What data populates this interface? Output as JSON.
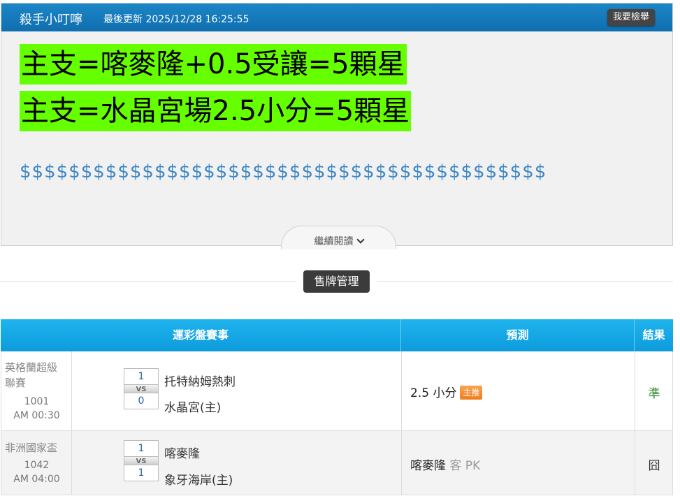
{
  "header": {
    "author": "殺手小叮嚀",
    "updated": "最後更新 2025/12/28 16:25:55",
    "report_button": "我要檢舉"
  },
  "article": {
    "headline_1": "主支=喀麥隆+0.5受讓=5顆星",
    "headline_2": "主支=水晶宮場2.5小分=5顆星",
    "dollar_line": "$$$$$$$$$$$$$$$$$$$$$$$$$$$$$$$$$$$$$$$$$$$",
    "read_more": "繼續閱讀"
  },
  "sell_button": "售牌管理",
  "table": {
    "headers": {
      "match": "運彩盤賽事",
      "prediction": "預測",
      "result": "結果"
    },
    "rows": [
      {
        "league_line1": "英格蘭超級",
        "league_line2": "聯賽",
        "number": "1001",
        "time": "AM 00:30",
        "score_top": "1",
        "vs": "VS",
        "score_bottom": "0",
        "team_top": "托特納姆熱刺",
        "team_bottom": "水晶宮(主)",
        "prediction": "2.5 小分",
        "badge": "主推",
        "result": "準"
      },
      {
        "league_line1": "非洲國家盃",
        "number": "1042",
        "time": "AM 04:00",
        "score_top": "1",
        "vs": "VS",
        "score_bottom": "1",
        "team_top": "喀麥隆",
        "team_bottom": "象牙海岸(主)",
        "prediction": "喀麥隆",
        "prediction_suffix": "客 PK",
        "result": "囧"
      }
    ]
  },
  "colors": {
    "header_blue": "#1479bd",
    "highlight_green": "#66ff00",
    "table_header_blue": "#15a8e6",
    "badge_orange": "#ef8425",
    "result_green": "#2c8a2c"
  }
}
